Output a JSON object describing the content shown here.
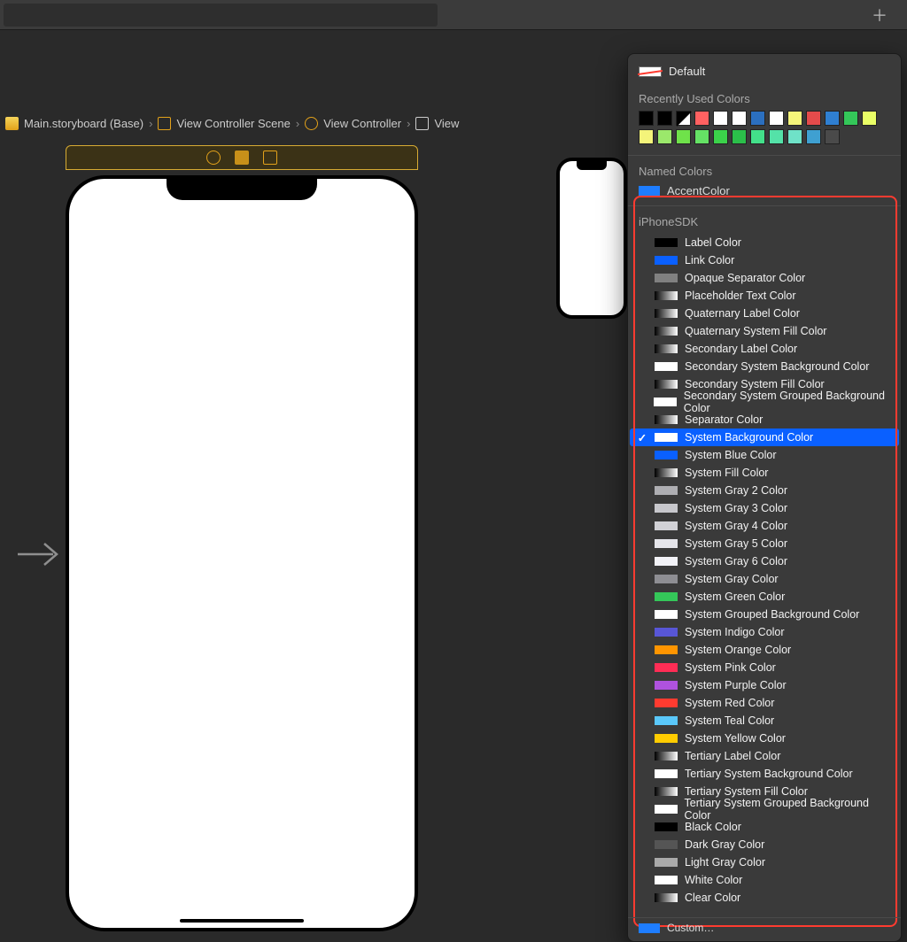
{
  "breadcrumb": {
    "items": [
      {
        "label": "Main.storyboard (Base)"
      },
      {
        "label": "View Controller Scene"
      },
      {
        "label": "View Controller"
      },
      {
        "label": "View"
      }
    ]
  },
  "popover": {
    "default_label": "Default",
    "recent_head": "Recently Used Colors",
    "named_head": "Named Colors",
    "sdk_head": "iPhoneSDK",
    "custom_label": "Custom…",
    "recent_colors": [
      "#000000",
      "#000000",
      "#ffffff",
      "#ff6161",
      "#ffffff",
      "#ffffff",
      "#2b6fbf",
      "#ffffff",
      "#f4f47a",
      "#e44b4b",
      "#2f7fd1",
      "#34c759",
      "#eaff66",
      "#f4f47a",
      "#9be86b",
      "#6fe24a",
      "#65e265",
      "#3bd24a",
      "#2bbf4a",
      "#43e08a",
      "#54e2a8",
      "#6fe2c8",
      "#3fa0d1",
      "#4a4a4a"
    ],
    "named_colors": [
      {
        "label": "AccentColor",
        "swatch": "#1e7dff"
      }
    ],
    "sdk_colors": [
      {
        "label": "Label Color",
        "swatch": "#000000",
        "gradient": false
      },
      {
        "label": "Link Color",
        "swatch": "#0a60ff",
        "gradient": false
      },
      {
        "label": "Opaque Separator Color",
        "swatch": "#808080",
        "gradient": false
      },
      {
        "label": "Placeholder Text Color",
        "swatch": "",
        "gradient": true
      },
      {
        "label": "Quaternary Label Color",
        "swatch": "",
        "gradient": true
      },
      {
        "label": "Quaternary System Fill Color",
        "swatch": "",
        "gradient": true
      },
      {
        "label": "Secondary Label Color",
        "swatch": "",
        "gradient": true
      },
      {
        "label": "Secondary System Background Color",
        "swatch": "#ffffff",
        "gradient": false
      },
      {
        "label": "Secondary System Fill Color",
        "swatch": "",
        "gradient": true
      },
      {
        "label": "Secondary System Grouped Background Color",
        "swatch": "#ffffff",
        "gradient": false
      },
      {
        "label": "Separator Color",
        "swatch": "",
        "gradient": true
      },
      {
        "label": "System Background Color",
        "swatch": "#ffffff",
        "gradient": false,
        "selected": true
      },
      {
        "label": "System Blue Color",
        "swatch": "#0a60ff",
        "gradient": false
      },
      {
        "label": "System Fill Color",
        "swatch": "",
        "gradient": true
      },
      {
        "label": "System Gray 2 Color",
        "swatch": "#aeaeb2",
        "gradient": false
      },
      {
        "label": "System Gray 3 Color",
        "swatch": "#c7c7cc",
        "gradient": false
      },
      {
        "label": "System Gray 4 Color",
        "swatch": "#d1d1d6",
        "gradient": false
      },
      {
        "label": "System Gray 5 Color",
        "swatch": "#e5e5ea",
        "gradient": false
      },
      {
        "label": "System Gray 6 Color",
        "swatch": "#f2f2f7",
        "gradient": false
      },
      {
        "label": "System Gray Color",
        "swatch": "#8e8e93",
        "gradient": false
      },
      {
        "label": "System Green Color",
        "swatch": "#34c759",
        "gradient": false
      },
      {
        "label": "System Grouped Background Color",
        "swatch": "#ffffff",
        "gradient": false
      },
      {
        "label": "System Indigo Color",
        "swatch": "#5856d6",
        "gradient": false
      },
      {
        "label": "System Orange Color",
        "swatch": "#ff9500",
        "gradient": false
      },
      {
        "label": "System Pink Color",
        "swatch": "#ff2d55",
        "gradient": false
      },
      {
        "label": "System Purple Color",
        "swatch": "#af52de",
        "gradient": false
      },
      {
        "label": "System Red Color",
        "swatch": "#ff3b30",
        "gradient": false
      },
      {
        "label": "System Teal Color",
        "swatch": "#5ac8fa",
        "gradient": false
      },
      {
        "label": "System Yellow Color",
        "swatch": "#ffcc00",
        "gradient": false
      },
      {
        "label": "Tertiary Label Color",
        "swatch": "",
        "gradient": true
      },
      {
        "label": "Tertiary System Background Color",
        "swatch": "#ffffff",
        "gradient": false
      },
      {
        "label": "Tertiary System Fill Color",
        "swatch": "",
        "gradient": true
      },
      {
        "label": "Tertiary System Grouped Background Color",
        "swatch": "#ffffff",
        "gradient": false
      },
      {
        "label": "Black Color",
        "swatch": "#000000",
        "gradient": false
      },
      {
        "label": "Dark Gray Color",
        "swatch": "#555555",
        "gradient": false
      },
      {
        "label": "Light Gray Color",
        "swatch": "#aaaaaa",
        "gradient": false
      },
      {
        "label": "White Color",
        "swatch": "#ffffff",
        "gradient": false
      },
      {
        "label": "Clear Color",
        "swatch": "",
        "gradient": true
      }
    ]
  }
}
